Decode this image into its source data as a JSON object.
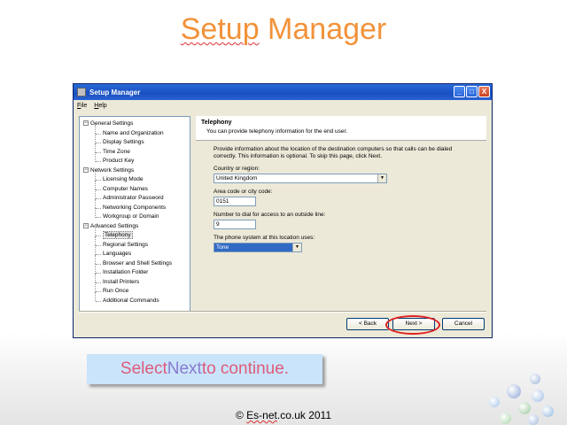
{
  "slide": {
    "title_part1": "Setup",
    "title_part2": " Manager",
    "callout_1": "Select ",
    "callout_2": "Next",
    "callout_3": " to continue.",
    "footer_1": "© ",
    "footer_2": "Es-net",
    "footer_3": ".co.uk 2011"
  },
  "window": {
    "title": "Setup Manager",
    "min": "_",
    "max": "□",
    "close": "X",
    "menu": [
      "File",
      "Help"
    ]
  },
  "tree": [
    {
      "label": "General Settings",
      "level": 0
    },
    {
      "label": "Name and Organization",
      "level": 1
    },
    {
      "label": "Display Settings",
      "level": 1
    },
    {
      "label": "Time Zone",
      "level": 1
    },
    {
      "label": "Product Key",
      "level": 1
    },
    {
      "label": "Network Settings",
      "level": 0
    },
    {
      "label": "Licensing Mode",
      "level": 1
    },
    {
      "label": "Computer Names",
      "level": 1
    },
    {
      "label": "Administrator Password",
      "level": 1
    },
    {
      "label": "Networking Components",
      "level": 1
    },
    {
      "label": "Workgroup or Domain",
      "level": 1
    },
    {
      "label": "Advanced Settings",
      "level": 0
    },
    {
      "label": "Telephony",
      "level": 1,
      "selected": true
    },
    {
      "label": "Regional Settings",
      "level": 1
    },
    {
      "label": "Languages",
      "level": 1
    },
    {
      "label": "Browser and Shell Settings",
      "level": 1
    },
    {
      "label": "Installation Folder",
      "level": 1
    },
    {
      "label": "Install Printers",
      "level": 1
    },
    {
      "label": "Run Once",
      "level": 1
    },
    {
      "label": "Additional Commands",
      "level": 1
    }
  ],
  "panel": {
    "title": "Telephony",
    "subtitle": "You can provide telephony information for the end user.",
    "description": "Provide information about the location of the destination computers so that calls can be dialed correctly. This information is optional. To skip this page, click Next.",
    "country_label": "Country or region:",
    "country_value": "United Kingdom",
    "area_label": "Area code or city code:",
    "area_value": "0151",
    "outside_label": "Number to dial for access to an outside line:",
    "outside_value": "9",
    "phone_label": "The phone system at this location uses:",
    "phone_value": "Tone"
  },
  "buttons": {
    "back": "< Back",
    "next": "Next >",
    "cancel": "Cancel"
  },
  "colors": {
    "title": "#f2923a",
    "callout_bg": "#c9e4fb",
    "highlight": "#e02020"
  }
}
